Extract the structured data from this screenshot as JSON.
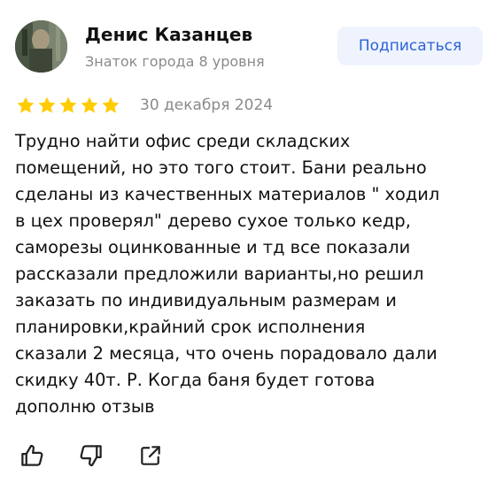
{
  "author": {
    "name": "Денис Казанцев",
    "level": "Знаток города 8 уровня",
    "avatar_icon": "avatar-photo"
  },
  "subscribe_label": "Подписаться",
  "rating": {
    "stars": 5,
    "max": 5,
    "star_color": "#ffcc00"
  },
  "review": {
    "date": "30 декабря 2024",
    "text": "Трудно найти офис среди складских\nпомещений, но это того стоит. Бани реально\nсделаны из качественных материалов \" ходил\nв цех проверял\" дерево сухое только кедр,\nсаморезы оцинкованные и тд все показали\nрассказали предложили варианты,но решил\nзаказать по индивидуальным размерам и\nпланировки,крайний срок исполнения\nсказали 2 месяца, что очень порадовало дали\nскидку 40т. Р. Когда баня будет готова\nдополню отзыв"
  },
  "actions": [
    {
      "icon": "thumbs-up-icon"
    },
    {
      "icon": "thumbs-down-icon"
    },
    {
      "icon": "share-icon"
    }
  ],
  "colors": {
    "accent": "#2c62d9",
    "button_bg": "#eef3fd",
    "muted_text": "#8a8a8a"
  }
}
